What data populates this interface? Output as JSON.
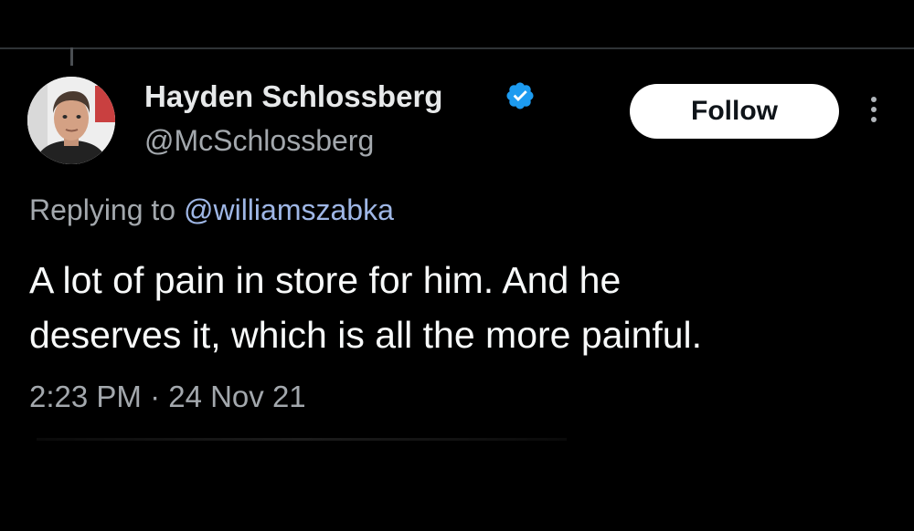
{
  "tweet": {
    "author": {
      "display_name": "Hayden Schlossberg",
      "handle": "@McSchlossberg",
      "verified": true,
      "avatar_icon": "user-avatar-photo"
    },
    "follow_label": "Follow",
    "more_icon": "more-vertical-icon",
    "replying_prefix": "Replying to",
    "replying_to": "@williamszabka",
    "text_lines": [
      "A lot of pain in store for him. And he",
      "deserves it, which is all the more painful."
    ],
    "timestamp": "2:23 PM · 24 Nov 21"
  },
  "colors": {
    "background": "#000000",
    "primary_text": "#e7e9ea",
    "secondary_text": "#a3a8ad",
    "link": "#9fb7e6",
    "verified": "#1d9bf0",
    "follow_bg": "#ffffff",
    "follow_text": "#0f1419"
  }
}
